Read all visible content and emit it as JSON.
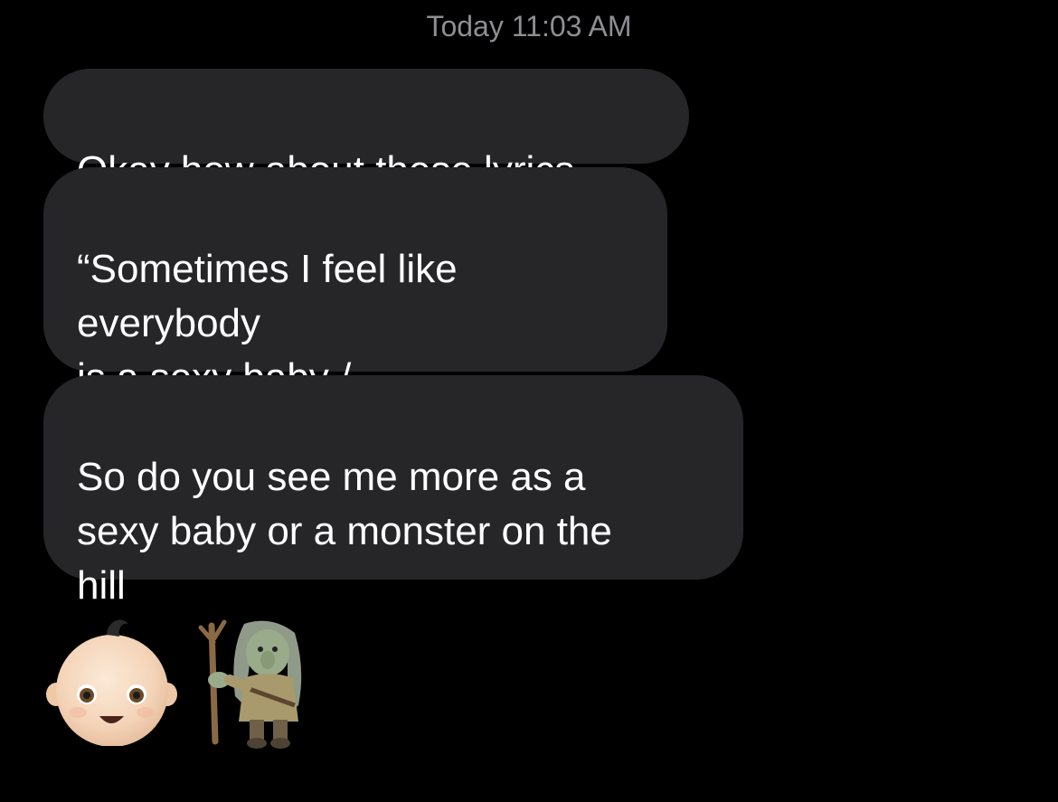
{
  "conversation": {
    "timestamp": "Today 11:03 AM",
    "messages": [
      {
        "text": "Okay how about these lyrics"
      },
      {
        "text": "“Sometimes I feel like everybody\nis a sexy baby /\nAnd I'm a monster on the hill”"
      },
      {
        "text": "So do you see me more as a\nsexy baby or a monster on the\nhill"
      }
    ],
    "reaction_emojis": [
      "baby-emoji",
      "troll-emoji"
    ]
  },
  "colors": {
    "background": "#000000",
    "bubble": "#262629",
    "text": "#ffffff",
    "timestamp": "#8e8e93"
  }
}
